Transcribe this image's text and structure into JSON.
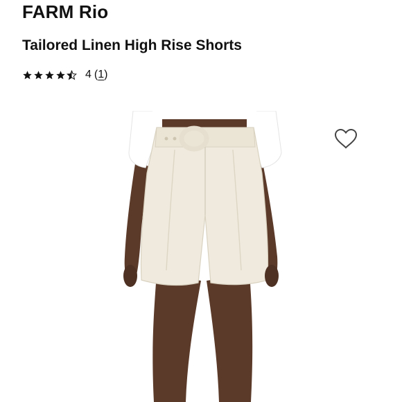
{
  "product": {
    "brand": "FARM Rio",
    "title": "Tailored Linen High Rise Shorts"
  },
  "rating": {
    "stars": 4.5,
    "star_icons": [
      "star-full-icon",
      "star-full-icon",
      "star-full-icon",
      "star-full-icon",
      "star-half-icon"
    ],
    "value": "4",
    "review_count_open": "(",
    "review_count": "1",
    "review_count_close": ")"
  },
  "image": {
    "subject": "product-photo",
    "shorts_color": "#efeadd",
    "top_color": "#ffffff",
    "skin_color": "#5b3a2a"
  },
  "wishlist": {
    "icon": "heart-icon"
  }
}
